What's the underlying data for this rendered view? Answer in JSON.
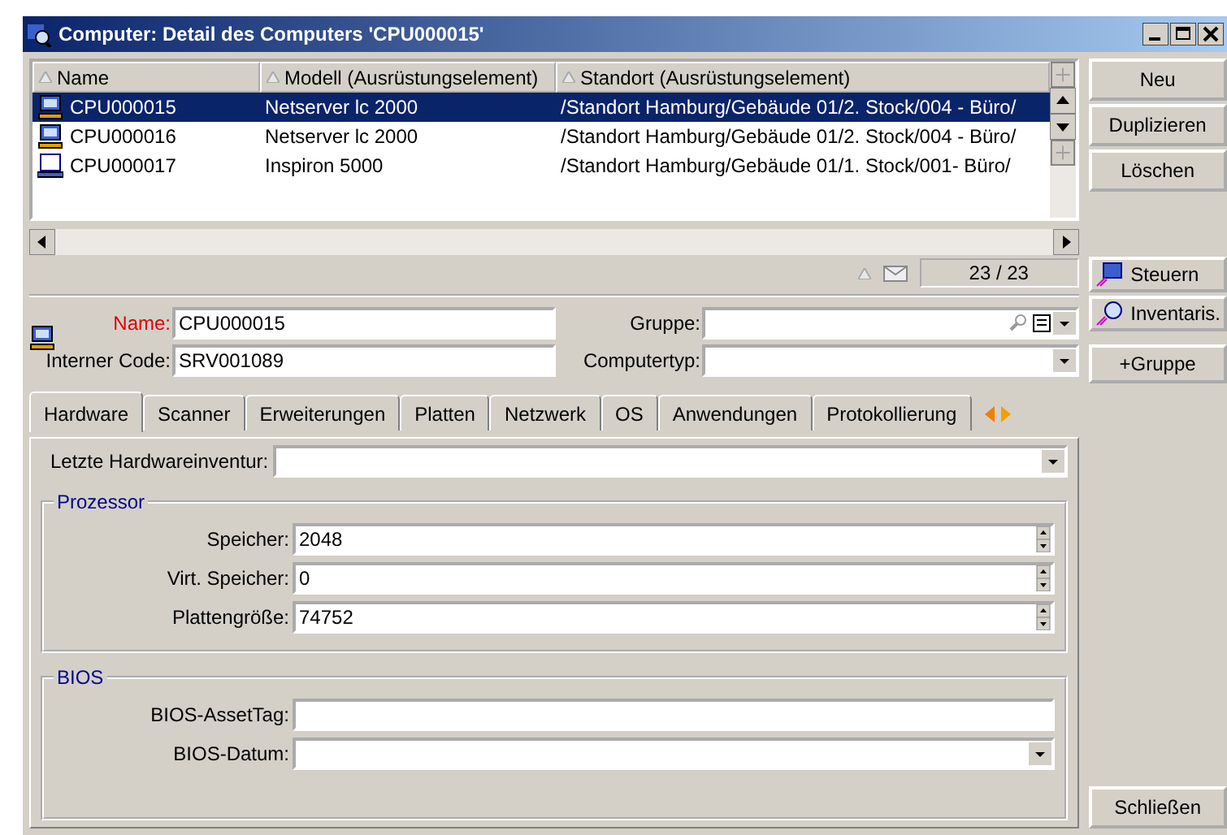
{
  "window": {
    "title": "Computer: Detail des Computers 'CPU000015'"
  },
  "list": {
    "columns": [
      "Name",
      "Modell (Ausrüstungselement)",
      "Standort (Ausrüstungselement)"
    ],
    "rows": [
      {
        "kind": "desktop",
        "selected": true,
        "cells": [
          "CPU000015",
          "Netserver lc 2000",
          "/Standort Hamburg/Gebäude 01/2. Stock/004 - Büro/"
        ]
      },
      {
        "kind": "desktop",
        "selected": false,
        "cells": [
          "CPU000016",
          "Netserver lc 2000",
          "/Standort Hamburg/Gebäude 01/2. Stock/004 - Büro/"
        ]
      },
      {
        "kind": "laptop",
        "selected": false,
        "cells": [
          "CPU000017",
          "Inspiron 5000",
          "/Standort Hamburg/Gebäude 01/1. Stock/001- Büro/"
        ]
      }
    ],
    "counter": "23 / 23"
  },
  "header": {
    "fields": [
      {
        "label": "Name:",
        "value": "CPU000015",
        "required": true,
        "kind": "text"
      },
      {
        "label": "Gruppe:",
        "required": false,
        "kind": "lookup"
      },
      {
        "label": "Interner Code:",
        "value": "SRV001089",
        "required": false,
        "kind": "text"
      },
      {
        "label": "Computertyp:",
        "required": false,
        "kind": "dropdown"
      }
    ]
  },
  "tabs": [
    {
      "label": "Hardware",
      "selected": true
    },
    {
      "label": "Scanner",
      "selected": false
    },
    {
      "label": "Erweiterungen",
      "selected": false
    },
    {
      "label": "Platten",
      "selected": false
    },
    {
      "label": "Netzwerk",
      "selected": false
    },
    {
      "label": "OS",
      "selected": false
    },
    {
      "label": "Anwendungen",
      "selected": false
    },
    {
      "label": "Protokollierung",
      "selected": false
    }
  ],
  "hardware": {
    "top_field": {
      "label": "Letzte Hardwareinventur:",
      "kind": "dropdown"
    },
    "groups": [
      {
        "title": "Prozessor",
        "fields": [
          {
            "label": "Speicher:",
            "value": "2048",
            "kind": "spin"
          },
          {
            "label": "Virt. Speicher:",
            "value": "0",
            "kind": "spin"
          },
          {
            "label": "Plattengröße:",
            "value": "74752",
            "kind": "spin"
          }
        ]
      },
      {
        "title": "BIOS",
        "fields": [
          {
            "label": "BIOS-AssetTag:",
            "kind": "text"
          },
          {
            "label": "BIOS-Datum:",
            "kind": "dropdown"
          }
        ]
      }
    ]
  },
  "buttons": [
    {
      "label": "Neu"
    },
    {
      "label": "Duplizieren"
    },
    {
      "label": "Löschen"
    }
  ],
  "actions": [
    {
      "label": "Steuern",
      "kind": "control"
    },
    {
      "label": "Inventaris.",
      "kind": "inventory"
    },
    {
      "label": "+Gruppe",
      "kind": "plain"
    }
  ],
  "close_button": "Schließen"
}
